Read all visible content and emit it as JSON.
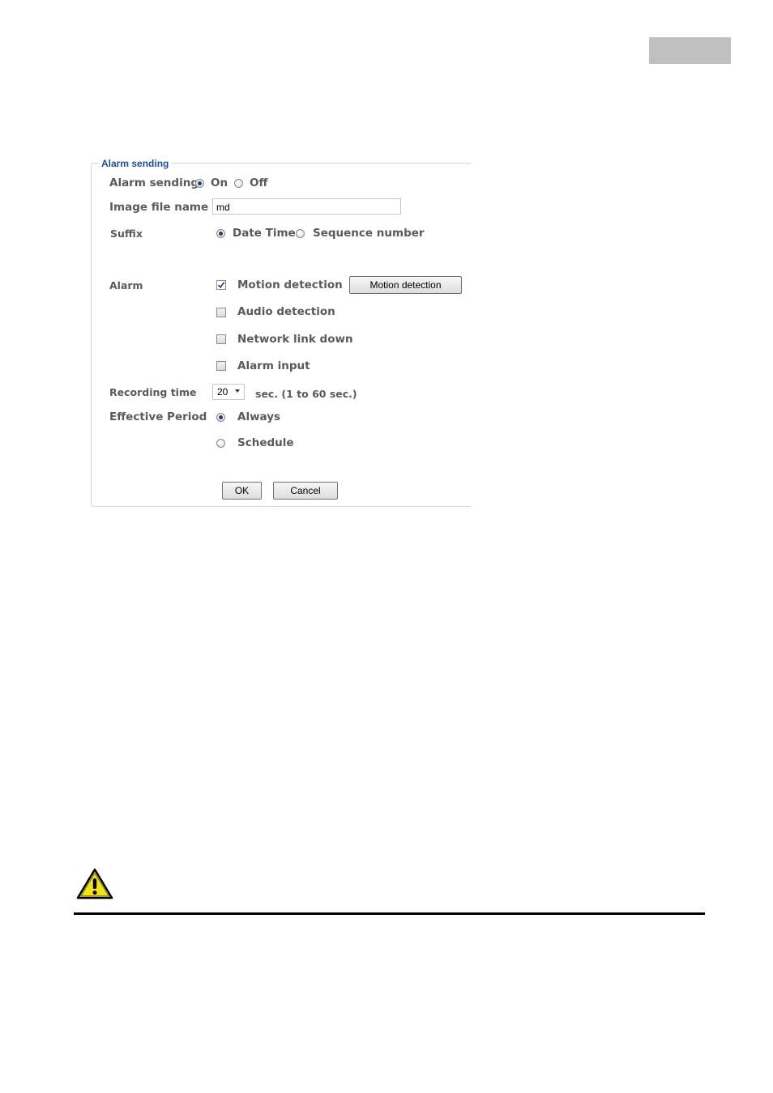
{
  "form": {
    "legend": "Alarm sending",
    "alarm_sending": {
      "label": "Alarm sending",
      "on_label": "On",
      "off_label": "Off",
      "selected": "On"
    },
    "image_file_name": {
      "label": "Image file name",
      "value": "md"
    },
    "suffix": {
      "label": "Suffix",
      "date_time_label": "Date Time",
      "sequence_label": "Sequence number",
      "selected": "Date Time"
    },
    "alarm": {
      "label": "Alarm",
      "options": [
        {
          "label": "Motion detection",
          "checked": true
        },
        {
          "label": "Audio detection",
          "checked": false
        },
        {
          "label": "Network link down",
          "checked": false
        },
        {
          "label": "Alarm input",
          "checked": false
        }
      ],
      "motion_button": "Motion detection"
    },
    "recording_time": {
      "label": "Recording time",
      "value": "20",
      "unit": "sec. (1 to 60 sec.)"
    },
    "effective_period": {
      "label": "Effective Period",
      "always_label": "Always",
      "schedule_label": "Schedule",
      "selected": "Always"
    },
    "ok_label": "OK",
    "cancel_label": "Cancel"
  },
  "colors": {
    "legend": "#1f4f8f",
    "label": "#5a5a5a",
    "warning_fill": "#f2e21c"
  },
  "icons": {
    "warning": "warning-triangle-icon",
    "dropdown": "chevron-down-icon"
  }
}
